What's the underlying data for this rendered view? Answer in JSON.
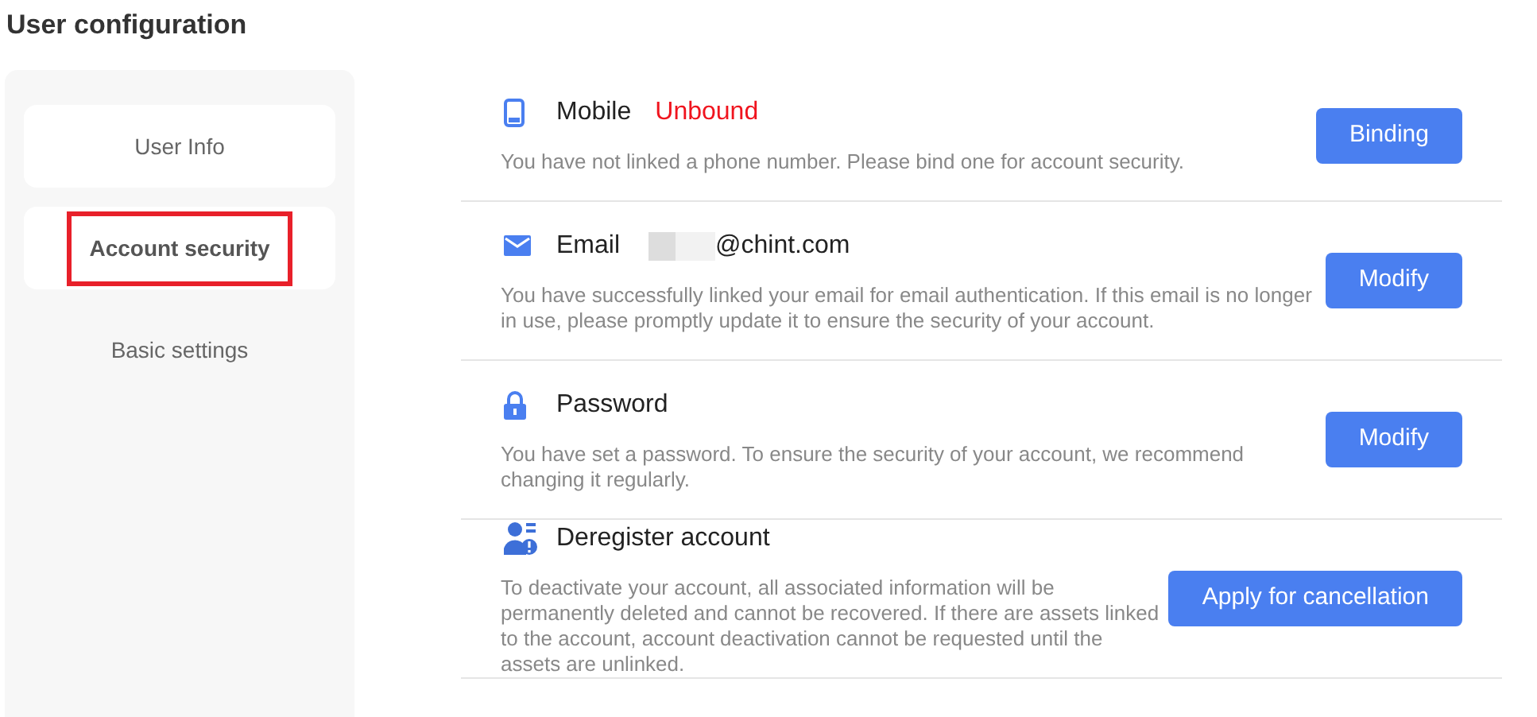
{
  "page_title": "User configuration",
  "sidebar": {
    "items": [
      {
        "label": "User Info",
        "kind": "card",
        "selected": false,
        "annotated": false
      },
      {
        "label": "Account security",
        "kind": "card",
        "selected": true,
        "annotated": true
      },
      {
        "label": "Basic settings",
        "kind": "plain",
        "selected": false,
        "annotated": false
      }
    ]
  },
  "settings": [
    {
      "kind": "mobile",
      "label": "Mobile",
      "value": {
        "text": "Unbound",
        "kind": "warning"
      },
      "description": "You have not linked a phone number. Please bind one for account security.",
      "button": "Binding"
    },
    {
      "kind": "email",
      "label": "Email",
      "value": {
        "text": "@chint.com",
        "kind": "redacted"
      },
      "description": "You have successfully linked your email for email authentication. If this email is no longer in use, please promptly update it to ensure the security of your account.",
      "button": "Modify"
    },
    {
      "kind": "password",
      "label": "Password",
      "description": "You have set a password. To ensure the security of your account, we recommend changing it regularly.",
      "button": "Modify"
    },
    {
      "kind": "deregister",
      "label": "Deregister account",
      "description": "To deactivate your account, all associated information will be permanently deleted and cannot be recovered. If there are assets linked to the account, account deactivation cannot be requested until the assets are unlinked.",
      "button": "Apply for cancellation"
    }
  ]
}
